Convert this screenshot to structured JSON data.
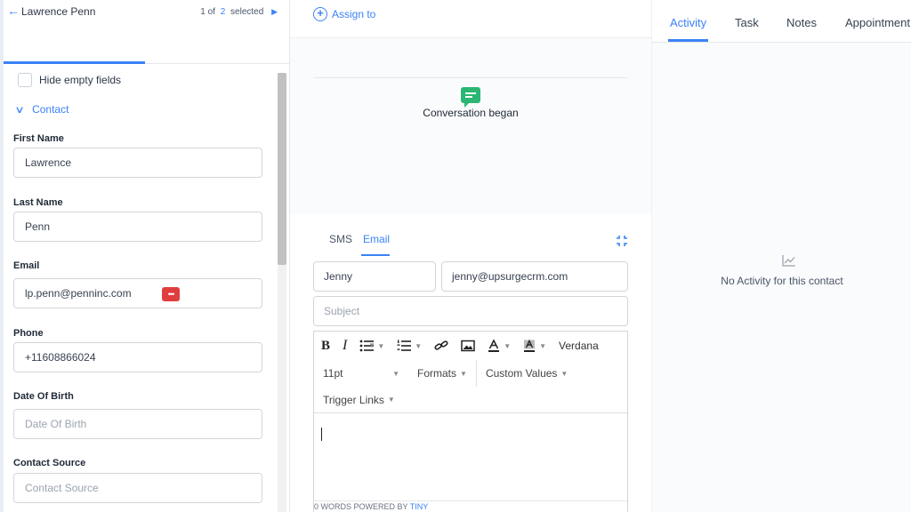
{
  "contact_header": {
    "name": "Lawrence Penn",
    "pager_prefix": "1 of",
    "pager_total": "2",
    "pager_suffix": "selected"
  },
  "contact_panel": {
    "hide_empty_label": "Hide empty fields",
    "section_label": "Contact",
    "fields": [
      {
        "label": "First Name",
        "value": "Lawrence",
        "placeholder": ""
      },
      {
        "label": "Last Name",
        "value": "Penn",
        "placeholder": ""
      },
      {
        "label": "Email",
        "value": "lp.penn@penninc.com",
        "placeholder": ""
      },
      {
        "label": "Phone",
        "value": "+11608866024",
        "placeholder": ""
      },
      {
        "label": "Date Of Birth",
        "value": "",
        "placeholder": "Date Of Birth"
      },
      {
        "label": "Contact Source",
        "value": "",
        "placeholder": "Contact Source"
      }
    ],
    "email_badge": "•••"
  },
  "conversation": {
    "assign_label": "Assign to",
    "event_text": "Conversation began"
  },
  "composer": {
    "tabs": [
      "SMS",
      "Email"
    ],
    "active_tab": "Email",
    "from_name": "Jenny",
    "from_email": "jenny@upsurgecrm.com",
    "subject_placeholder": "Subject",
    "toolbar": {
      "font_name": "Verdana",
      "font_size": "11pt",
      "formats": "Formats",
      "custom_values": "Custom Values",
      "trigger_links": "Trigger Links"
    },
    "status_words": "0 WORDS POWERED BY",
    "status_brand": "TINY"
  },
  "right_panel": {
    "tabs": [
      "Activity",
      "Task",
      "Notes",
      "Appointment"
    ],
    "active_tab": "Activity",
    "empty_message": "No Activity for this contact"
  },
  "colors": {
    "accent": "#3b82f6",
    "conversation_icon": "#2bb673",
    "badge": "#e03e3e"
  }
}
